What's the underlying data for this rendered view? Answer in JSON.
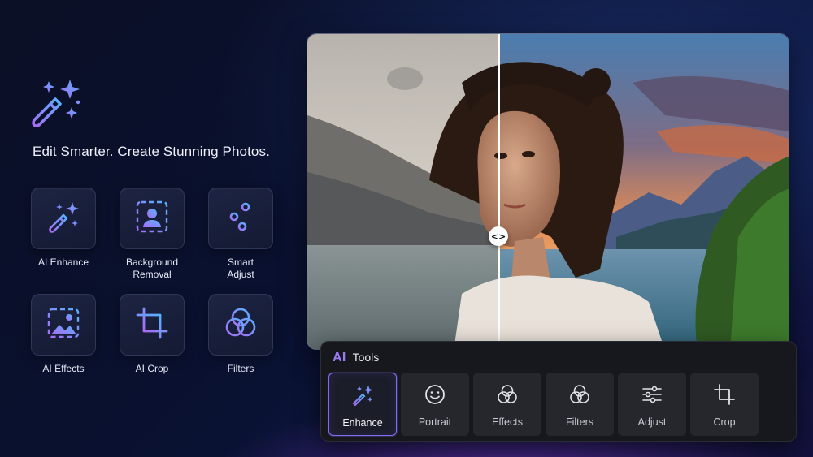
{
  "tagline": "Edit Smarter. Create Stunning Photos.",
  "hero_icon": "magic-wand-sparkle-icon",
  "tool_grid": [
    {
      "label_lines": [
        "AI Enhance"
      ],
      "icon": "magic-wand-icon"
    },
    {
      "label_lines": [
        "Background",
        "Removal"
      ],
      "icon": "person-frame-icon"
    },
    {
      "label_lines": [
        "Smart",
        "Adjust"
      ],
      "icon": "sliders-icon"
    },
    {
      "label_lines": [
        "AI Effects"
      ],
      "icon": "image-icon"
    },
    {
      "label_lines": [
        "AI Crop"
      ],
      "icon": "crop-icon"
    },
    {
      "label_lines": [
        "Filters"
      ],
      "icon": "filters-icon"
    }
  ],
  "compare": {
    "handle_glyph": "<>",
    "split_position": 0.398
  },
  "panel": {
    "badge": "AI",
    "title": "Tools",
    "tools": [
      {
        "label": "Enhance",
        "icon": "magic-wand-icon",
        "active": true
      },
      {
        "label": "Portrait",
        "icon": "smiley-face-icon",
        "active": false
      },
      {
        "label": "Effects",
        "icon": "effects-circles-icon",
        "active": false
      },
      {
        "label": "Filters",
        "icon": "filters-icon",
        "active": false
      },
      {
        "label": "Adjust",
        "icon": "sliders-icon",
        "active": false
      },
      {
        "label": "Crop",
        "icon": "crop-icon",
        "active": false
      }
    ]
  },
  "colors": {
    "accent_purple": "#9c7cf5",
    "accent_blue": "#5aa2ff",
    "background": "#0b1026",
    "panel": "#17181d"
  }
}
